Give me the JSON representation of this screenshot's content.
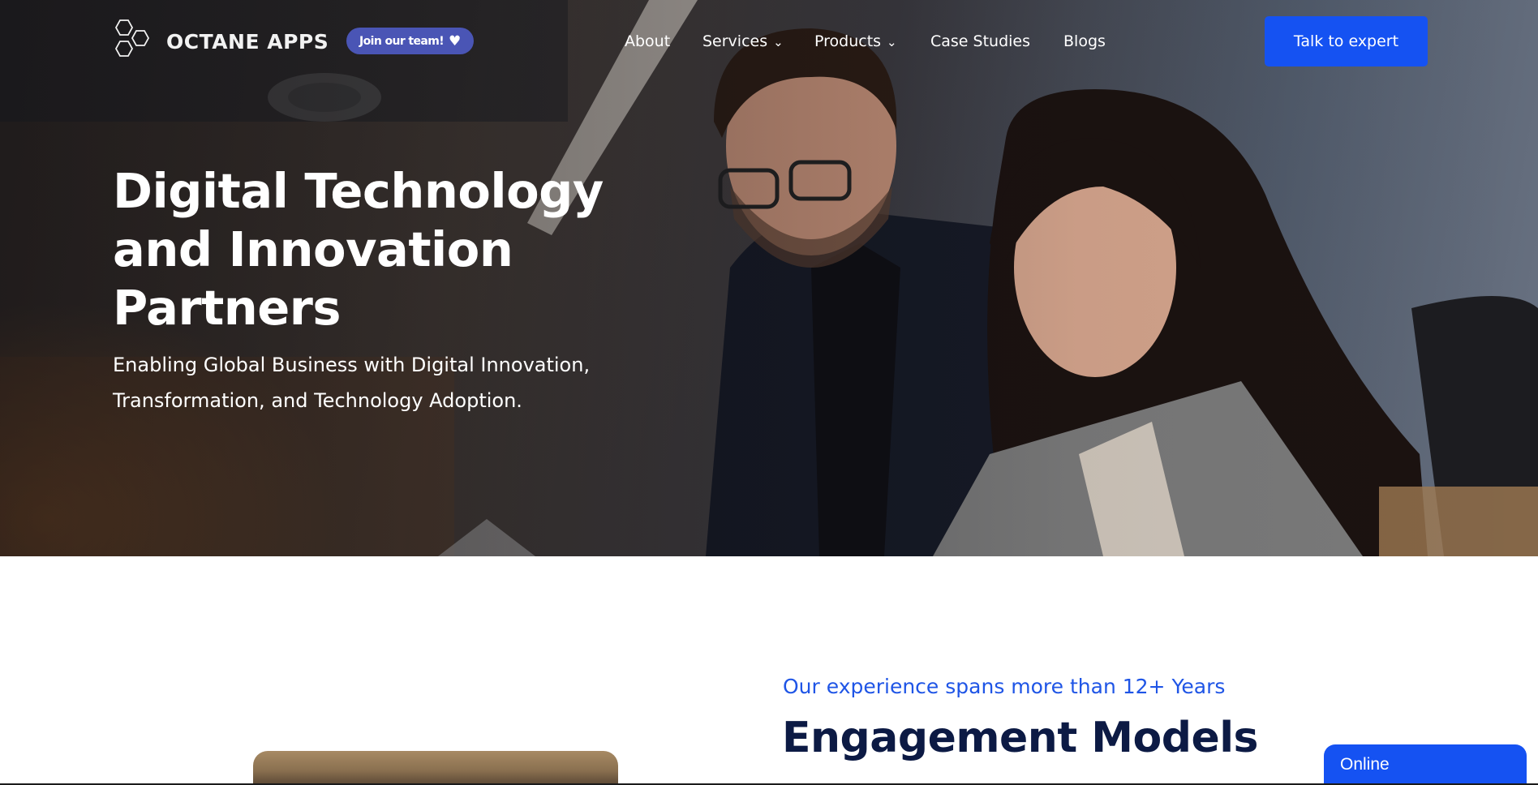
{
  "header": {
    "logo_text": "OCTANE APPS",
    "join_badge_label": "Join our team!",
    "nav": [
      {
        "label": "About",
        "has_dropdown": false
      },
      {
        "label": "Services",
        "has_dropdown": true
      },
      {
        "label": "Products",
        "has_dropdown": true
      },
      {
        "label": "Case Studies",
        "has_dropdown": false
      },
      {
        "label": "Blogs",
        "has_dropdown": false
      }
    ],
    "cta_label": "Talk to expert"
  },
  "hero": {
    "title_lines": [
      "Digital Technology",
      "and Innovation",
      "Partners"
    ],
    "subtitle_lines": [
      "Enabling Global Business with Digital Innovation,",
      "Transformation, and Technology Adoption."
    ]
  },
  "engagement": {
    "experience_text": "Our experience spans more than 12+ Years",
    "title": "Engagement Models"
  },
  "chat_widget": {
    "label": "Online"
  },
  "colors": {
    "accent_blue": "#1552f2",
    "badge_purple": "#4a55b5",
    "heading_navy": "#0c1a44",
    "subheading_blue": "#1f55e6"
  },
  "icons": {
    "logo": "hexagon-cluster-icon",
    "badge": "heart-icon",
    "dropdown": "chevron-down-icon"
  }
}
